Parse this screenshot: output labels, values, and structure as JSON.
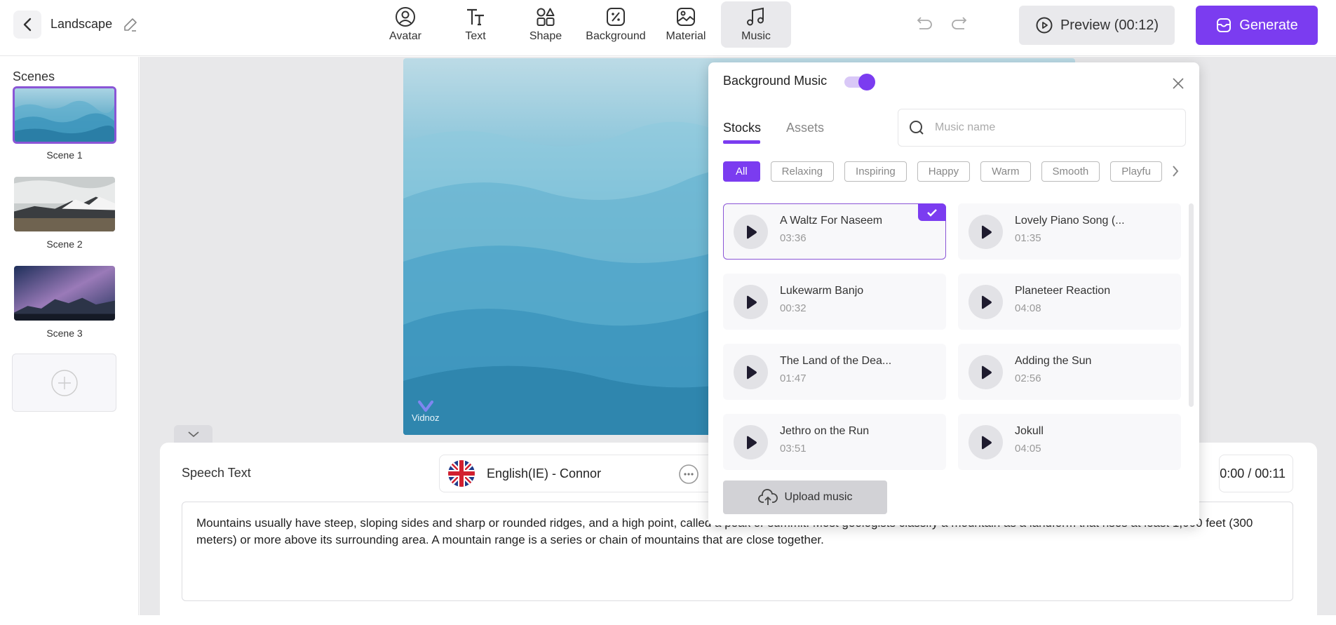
{
  "header": {
    "project_title": "Landscape",
    "tools": [
      {
        "label": "Avatar",
        "icon": "avatar-icon"
      },
      {
        "label": "Text",
        "icon": "text-icon"
      },
      {
        "label": "Shape",
        "icon": "shape-icon"
      },
      {
        "label": "Background",
        "icon": "background-icon"
      },
      {
        "label": "Material",
        "icon": "material-icon"
      },
      {
        "label": "Music",
        "icon": "music-icon",
        "active": true
      }
    ],
    "preview_label": "Preview (00:12)",
    "generate_label": "Generate",
    "accent_color": "#7b3cf0"
  },
  "sidebar": {
    "title": "Scenes",
    "scenes": [
      {
        "label": "Scene 1",
        "selected": true
      },
      {
        "label": "Scene 2"
      },
      {
        "label": "Scene 3"
      }
    ]
  },
  "canvas": {
    "watermark": "Vidnoz"
  },
  "speech": {
    "label": "Speech Text",
    "voice": "English(IE) - Connor",
    "time": "00:00 / 00:11",
    "text": "Mountains usually have steep, sloping sides and sharp or rounded ridges, and a high point, called a peak or summit. Most geologists classify a mountain as a landform that rises at least 1,000 feet (300 meters) or more above its surrounding area. A mountain range is a series or chain of mountains that are close together."
  },
  "music_panel": {
    "title": "Background Music",
    "enabled": true,
    "tabs": [
      "Stocks",
      "Assets"
    ],
    "active_tab": "Stocks",
    "search_placeholder": "Music name",
    "search_value": "",
    "categories": [
      "All",
      "Relaxing",
      "Inspiring",
      "Happy",
      "Warm",
      "Smooth",
      "Playfu"
    ],
    "active_category": "All",
    "tracks": [
      {
        "name": "A Waltz For Naseem",
        "duration": "03:36",
        "selected": true
      },
      {
        "name": "Lovely Piano Song (...",
        "duration": "01:35"
      },
      {
        "name": "Lukewarm Banjo",
        "duration": "00:32"
      },
      {
        "name": "Planeteer Reaction",
        "duration": "04:08"
      },
      {
        "name": "The Land of the Dea...",
        "duration": "01:47"
      },
      {
        "name": "Adding the Sun",
        "duration": "02:56"
      },
      {
        "name": "Jethro on the Run",
        "duration": "03:51"
      },
      {
        "name": "Jokull",
        "duration": "04:05"
      }
    ],
    "upload_label": "Upload music"
  }
}
